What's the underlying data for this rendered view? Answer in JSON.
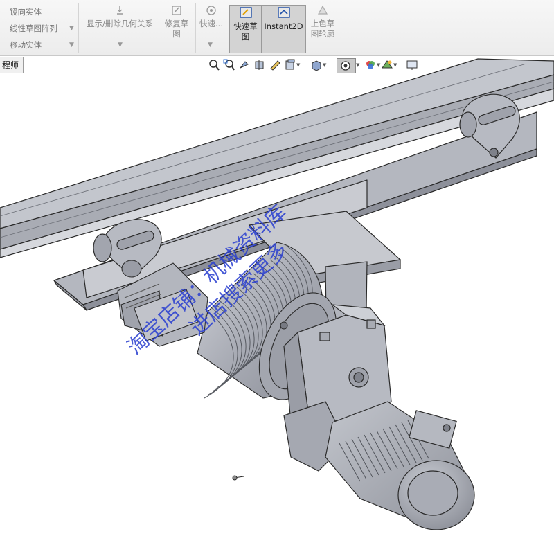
{
  "ribbon": {
    "left_items": [
      {
        "label": "镜向实体",
        "icon": "mirror-icon"
      },
      {
        "label": "线性草图阵列",
        "icon": "linear-pattern-icon"
      },
      {
        "label": "移动实体",
        "icon": "move-entities-icon"
      }
    ],
    "show_delete_relations": "显示/删除几何关系",
    "repair_sketch_line1": "修复草",
    "repair_sketch_line2": "图",
    "quick_snap": "快速...",
    "rapid_sketch_line1": "快速草",
    "rapid_sketch_line2": "图",
    "instant2d": "Instant2D",
    "shaded_contours_line1": "上色草",
    "shaded_contours_line2": "图轮廓"
  },
  "tab": {
    "label": "程师"
  },
  "view_toolbar": {
    "icons": [
      "zoom-to-fit-icon",
      "zoom-to-area-icon",
      "previous-view-icon",
      "section-view-icon",
      "dynamic-annotation-icon",
      "view-orientation-icon",
      "display-style-icon",
      "hide-show-items-icon",
      "edit-appearance-icon",
      "apply-scene-icon",
      "view-settings-icon"
    ]
  },
  "watermark": {
    "line1": "淘宝店铺：机械资料库",
    "line2": "进店搜索更多"
  },
  "colors": {
    "steel": "#b9bcc6",
    "steel_dark": "#8d909a",
    "outline": "#2a2a2a",
    "watermark": "#2a3fd0",
    "ribbon_bg": "#ececec",
    "active_btn": "#d3d3d3"
  }
}
